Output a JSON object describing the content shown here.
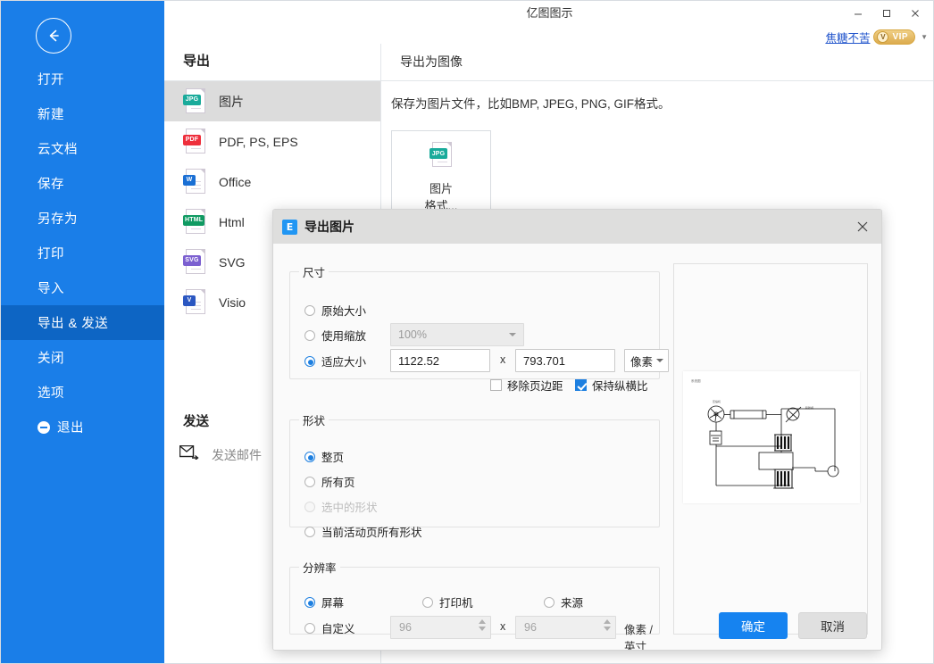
{
  "window": {
    "title": "亿图图示",
    "minimize": "–",
    "maximize": "☐",
    "close": "✕",
    "user_name": "焦糖不苦",
    "vip_badge": "VIP",
    "vip_mark": "V"
  },
  "sidebar": {
    "back_icon": "back-arrow-icon",
    "items": [
      {
        "label": "打开"
      },
      {
        "label": "新建"
      },
      {
        "label": "云文档"
      },
      {
        "label": "保存"
      },
      {
        "label": "另存为"
      },
      {
        "label": "打印"
      },
      {
        "label": "导入"
      },
      {
        "label": "导出 & 发送",
        "active": true
      },
      {
        "label": "关闭"
      },
      {
        "label": "选项"
      },
      {
        "label": "退出",
        "icon": "exit-icon"
      }
    ]
  },
  "export_panel": {
    "heading": "导出",
    "formats": [
      {
        "label": "图片",
        "tag": "JPG",
        "color": "#1aab9b",
        "selected": true
      },
      {
        "label": "PDF, PS, EPS",
        "tag": "PDF",
        "color": "#ee2f3c",
        "selected": false
      },
      {
        "label": "Office",
        "tag": "W",
        "color": "#1a6fd4",
        "selected": false
      },
      {
        "label": "Html",
        "tag": "HTML",
        "color": "#109a62",
        "selected": false
      },
      {
        "label": "SVG",
        "tag": "SVG",
        "color": "#7b5fd0",
        "selected": false
      },
      {
        "label": "Visio",
        "tag": "V",
        "color": "#2b57c1",
        "selected": false
      }
    ],
    "send_heading": "发送",
    "send_mail_label": "发送邮件"
  },
  "detail_panel": {
    "heading": "导出为图像",
    "description": "保存为图片文件，比如BMP, JPEG, PNG, GIF格式。",
    "card": {
      "tag": "JPG",
      "line1": "图片",
      "line2": "格式..."
    }
  },
  "dialog": {
    "title": "导出图片",
    "logo": "E",
    "close": "✕",
    "size": {
      "legend": "尺寸",
      "original_label": "原始大小",
      "original_checked": false,
      "scale_label": "使用缩放",
      "scale_checked": false,
      "scale_value": "100%",
      "fit_label": "适应大小",
      "fit_checked": true,
      "width_value": "1122.52",
      "x_sep": "x",
      "height_value": "793.701",
      "unit_value": "像素",
      "remove_margin_label": "移除页边距",
      "remove_margin_checked": false,
      "keep_ratio_label": "保持纵横比",
      "keep_ratio_checked": true
    },
    "shape": {
      "legend": "形状",
      "options": [
        {
          "label": "整页",
          "checked": true,
          "disabled": false
        },
        {
          "label": "所有页",
          "checked": false,
          "disabled": false
        },
        {
          "label": "选中的形状",
          "checked": false,
          "disabled": true
        },
        {
          "label": "当前活动页所有形状",
          "checked": false,
          "disabled": false
        }
      ]
    },
    "resolution": {
      "legend": "分辨率",
      "screen_label": "屏幕",
      "screen_checked": true,
      "printer_label": "打印机",
      "printer_checked": false,
      "source_label": "来源",
      "source_checked": false,
      "custom_label": "自定义",
      "custom_checked": false,
      "dpi_x": "96",
      "x_sep": "x",
      "dpi_y": "96",
      "unit": "像素 / 英寸"
    },
    "preview": {
      "page_title": "系统图"
    },
    "ok_label": "确定",
    "cancel_label": "取消"
  },
  "colors": {
    "sidebar_blue": "#1a7ee8",
    "sidebar_active": "#0d65c4",
    "accent_blue": "#1683f0",
    "radio_blue": "#1d7fe0"
  }
}
